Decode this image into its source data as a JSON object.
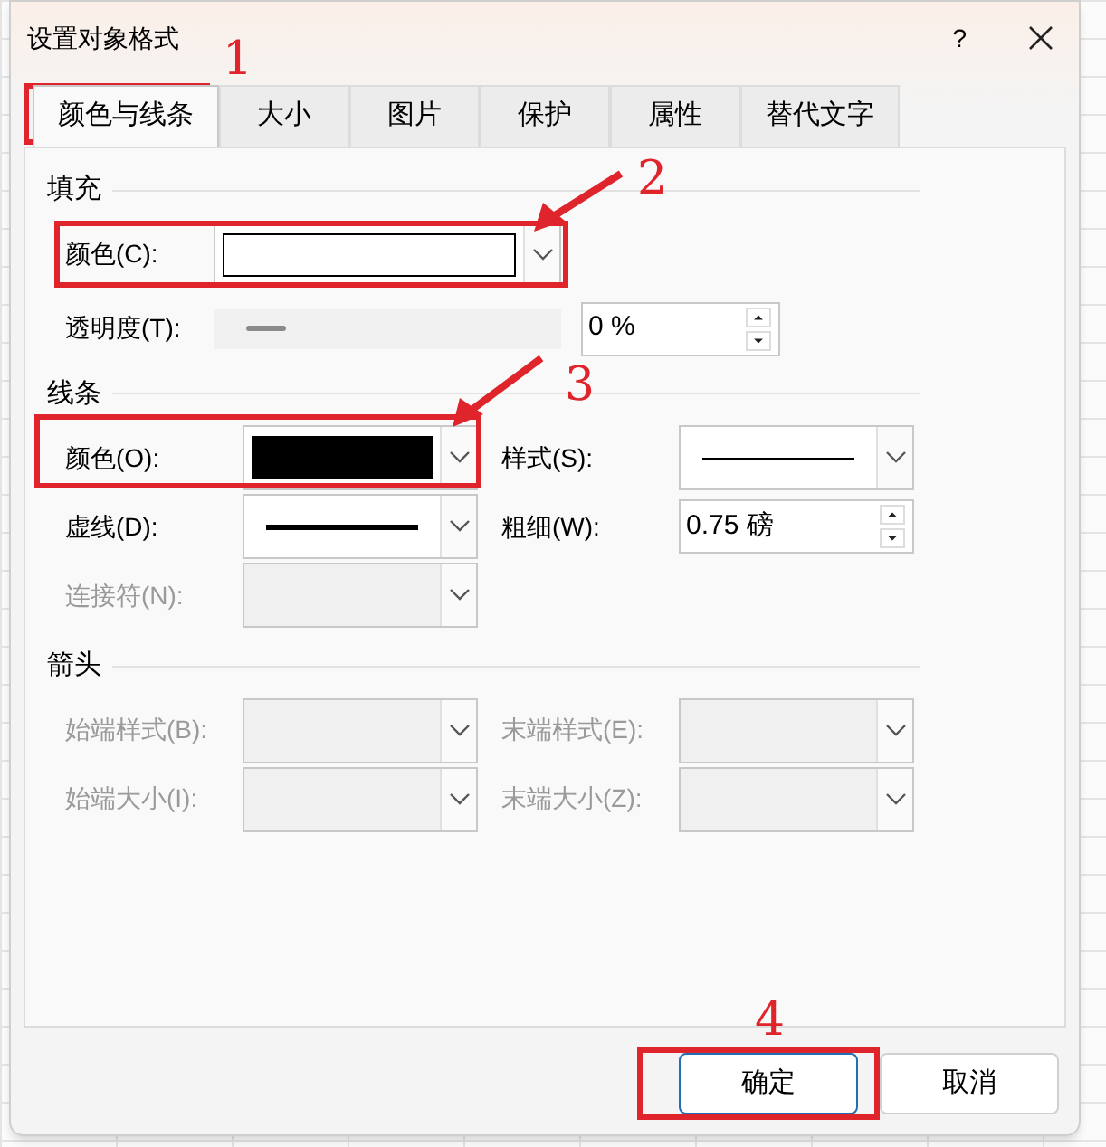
{
  "window": {
    "title": "设置对象格式",
    "help": "?"
  },
  "tabs": [
    {
      "label": "颜色与线条",
      "selected": true
    },
    {
      "label": "大小",
      "selected": false
    },
    {
      "label": "图片",
      "selected": false
    },
    {
      "label": "保护",
      "selected": false
    },
    {
      "label": "属性",
      "selected": false
    },
    {
      "label": "替代文字",
      "selected": false
    }
  ],
  "sections": [
    {
      "title": "填充",
      "kind": "fill",
      "rows": [
        [
          {
            "label": "颜色(C):",
            "disabled": false,
            "kind": "combo",
            "sample": {
              "kind": "swatch",
              "color": "#ffffff"
            }
          }
        ],
        [
          {
            "label": "透明度(T):",
            "disabled": false,
            "kind": "slider",
            "level": 0.15,
            "value": "0 %"
          }
        ]
      ]
    },
    {
      "title": "线条",
      "kind": "lines",
      "rows": [
        [
          {
            "label": "颜色(O):",
            "disabled": false,
            "kind": "combo",
            "sample": {
              "kind": "swatch",
              "color": "#000000"
            }
          },
          {
            "label": "样式(S):",
            "disabled": false,
            "kind": "combo",
            "sample": {
              "kind": "thin"
            }
          }
        ],
        [
          {
            "label": "虚线(D):",
            "disabled": false,
            "kind": "combo",
            "sample": {
              "kind": "thick"
            }
          },
          {
            "label": "粗细(W):",
            "disabled": false,
            "kind": "spinner",
            "value": "0.75 磅"
          }
        ],
        [
          {
            "label": "连接符(N):",
            "disabled": true,
            "kind": "combo"
          }
        ]
      ]
    },
    {
      "title": "箭头",
      "kind": "lines",
      "rows": [
        [
          {
            "label": "始端样式(B):",
            "disabled": true,
            "kind": "combo"
          },
          {
            "label": "末端样式(E):",
            "disabled": true,
            "kind": "combo"
          }
        ],
        [
          {
            "label": "始端大小(I):",
            "disabled": true,
            "kind": "combo"
          },
          {
            "label": "末端大小(Z):",
            "disabled": true,
            "kind": "combo"
          }
        ]
      ]
    }
  ],
  "buttons": [
    {
      "label": "确定",
      "default": true
    },
    {
      "label": "取消",
      "default": false
    }
  ],
  "annotations": [
    "1",
    "2",
    "3",
    "4"
  ]
}
